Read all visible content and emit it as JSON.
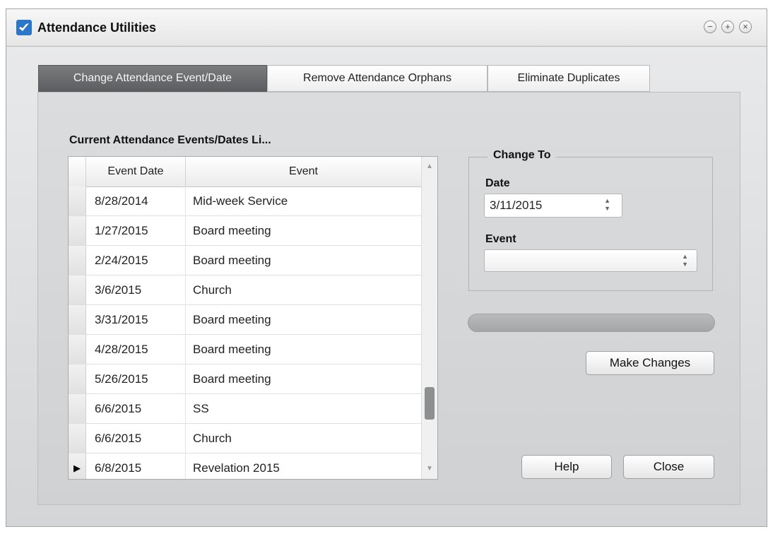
{
  "window": {
    "title": "Attendance Utilities",
    "controls": [
      "minimize-icon",
      "maximize-icon",
      "close-icon"
    ]
  },
  "tabs": [
    {
      "label": "Change Attendance Event/Date",
      "active": true
    },
    {
      "label": "Remove Attendance Orphans",
      "active": false
    },
    {
      "label": "Eliminate Duplicates",
      "active": false
    }
  ],
  "list": {
    "title": "Current Attendance Events/Dates Li...",
    "columns": [
      "Event Date",
      "Event"
    ],
    "rows": [
      {
        "date": "8/28/2014",
        "event": "Mid-week Service"
      },
      {
        "date": "1/27/2015",
        "event": "Board meeting"
      },
      {
        "date": "2/24/2015",
        "event": "Board meeting"
      },
      {
        "date": "3/6/2015",
        "event": "Church"
      },
      {
        "date": "3/31/2015",
        "event": "Board meeting"
      },
      {
        "date": "4/28/2015",
        "event": "Board meeting"
      },
      {
        "date": "5/26/2015",
        "event": "Board meeting"
      },
      {
        "date": "6/6/2015",
        "event": "SS"
      },
      {
        "date": "6/6/2015",
        "event": "Church"
      },
      {
        "date": "6/8/2015",
        "event": "Revelation 2015",
        "current": true
      }
    ],
    "current_marker": "▶"
  },
  "change_to": {
    "legend": "Change To",
    "date_label": "Date",
    "date_value": "3/11/2015",
    "event_label": "Event",
    "event_value": ""
  },
  "progress": {
    "value": 0
  },
  "buttons": {
    "make_changes": "Make Changes",
    "help": "Help",
    "close": "Close"
  },
  "colors": {
    "active_tab": "#5f6164",
    "panel": "#d4d6d8",
    "progress_track": "#a9abad"
  }
}
